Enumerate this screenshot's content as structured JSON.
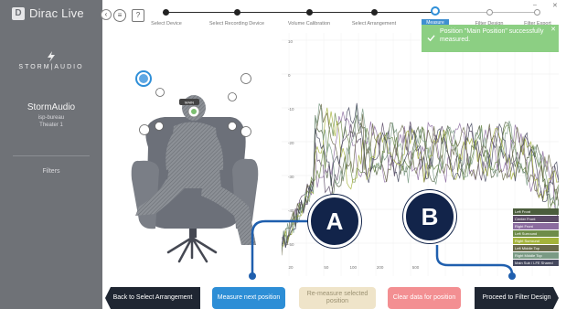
{
  "app": {
    "logo_text": "Dirac Live",
    "logo_mark": "D",
    "brand": "STORM|AUDIO",
    "device_name": "StormAudio",
    "device_sub1": "isp-bureau",
    "device_sub2": "Theater 1",
    "sidebar_filters": "Filters",
    "collapse_icon": "‹",
    "menu_icon": "≡",
    "help_icon": "?",
    "win_minimize": "–",
    "win_close": "✕"
  },
  "steps": [
    {
      "label": "Select Device"
    },
    {
      "label": "Select Recording Device"
    },
    {
      "label": "Volume Calibration"
    },
    {
      "label": "Select Arrangement"
    },
    {
      "label": "Measure"
    },
    {
      "label": "Filter Design"
    },
    {
      "label": "Filter Export"
    }
  ],
  "notification": {
    "text": "Position \"Main Position\" successfully measured.",
    "close": "✕"
  },
  "scene": {
    "main_position_label": "MAIN"
  },
  "chart_data": {
    "type": "line",
    "y_ticks": [
      "10",
      "0",
      "-10",
      "-20",
      "-30",
      "-40",
      "-50"
    ],
    "x_ticks": [
      "20",
      "50",
      "100",
      "200",
      "500"
    ],
    "legend": [
      {
        "name": "Left Front",
        "color": "#4b5d3c"
      },
      {
        "name": "Center Front",
        "color": "#5b4a66"
      },
      {
        "name": "Right Front",
        "color": "#8b6b9f"
      },
      {
        "name": "Left Surround",
        "color": "#6e8c49"
      },
      {
        "name": "Right Surround",
        "color": "#a4b33b"
      },
      {
        "name": "Left Middle Top",
        "color": "#6a6a4a"
      },
      {
        "name": "Right Middle Top",
        "color": "#7a9a84"
      },
      {
        "name": "Main Sub / LFE Shared",
        "color": "#45485e"
      }
    ]
  },
  "buttons": {
    "back": "Back to Select Arrangement",
    "measure": "Measure next position",
    "remeasure": "Re-measure selected position",
    "clear": "Clear data for position",
    "proceed": "Proceed to Filter Design"
  },
  "callouts": {
    "a": "A",
    "b": "B"
  }
}
